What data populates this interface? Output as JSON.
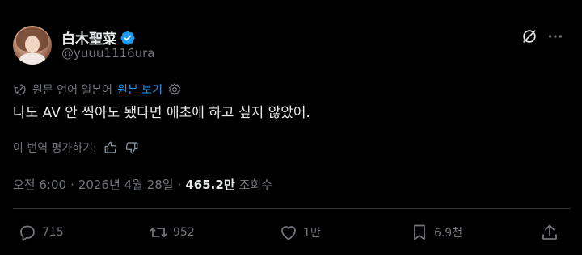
{
  "author": {
    "display_name": "白木聖菜",
    "handle": "@yuuu1116ura"
  },
  "translation": {
    "source_label": "원문 언어 일본어",
    "show_original_label": "원본 보기"
  },
  "tweet": {
    "text": "나도 AV 안 찍아도 됐다면 애초에 하고 싶지 않았어."
  },
  "rating": {
    "label": "이 번역 평가하기:"
  },
  "meta": {
    "time": "오전 6:00",
    "separator": "·",
    "date": "2026년 4월 28일",
    "views_count": "465.2만",
    "views_label": "조회수"
  },
  "actions": {
    "reply_count": "715",
    "repost_count": "952",
    "like_count": "1만",
    "bookmark_count": "6.9천"
  },
  "colors": {
    "background": "#000000",
    "text": "#e7e9ea",
    "muted": "#71767b",
    "accent": "#1d9bf0",
    "divider": "#2f3336"
  },
  "icons": [
    "verified-badge-icon",
    "grok-icon",
    "more-icon",
    "translate-icon",
    "settings-icon",
    "thumbs-up-icon",
    "thumbs-down-icon",
    "reply-icon",
    "repost-icon",
    "like-icon",
    "bookmark-icon",
    "share-icon"
  ]
}
